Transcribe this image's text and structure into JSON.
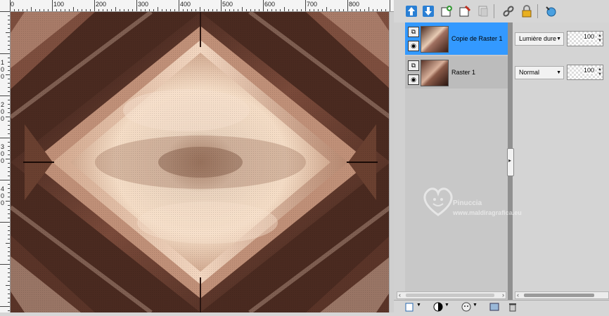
{
  "ruler": {
    "top_labels": [
      "0",
      "100",
      "200",
      "300",
      "400",
      "500",
      "600",
      "700",
      "800"
    ],
    "left_labels": [
      "1",
      "0",
      "0",
      "2",
      "0",
      "0",
      "3",
      "0",
      "0",
      "4",
      "0",
      "0"
    ]
  },
  "toolbar": {
    "icons": [
      "layer-up-icon",
      "layer-down-icon",
      "new-layer-icon",
      "delete-layer-icon",
      "duplicate-layer-icon",
      "link-icon",
      "lock-icon",
      "refresh-icon"
    ]
  },
  "layers": [
    {
      "name": "Copie de Raster 1",
      "blend": "Lumière dure",
      "opacity": "100",
      "selected": true
    },
    {
      "name": "Raster 1",
      "blend": "Normal",
      "opacity": "100",
      "selected": false
    }
  ],
  "watermark": {
    "line1": "Pinuccia",
    "line2": "www.maldiragrafica.eu"
  },
  "colors": {
    "selected_row": "#3399ff",
    "panel_bg": "#d4d4d4",
    "list_bg": "#c8c8c8"
  }
}
